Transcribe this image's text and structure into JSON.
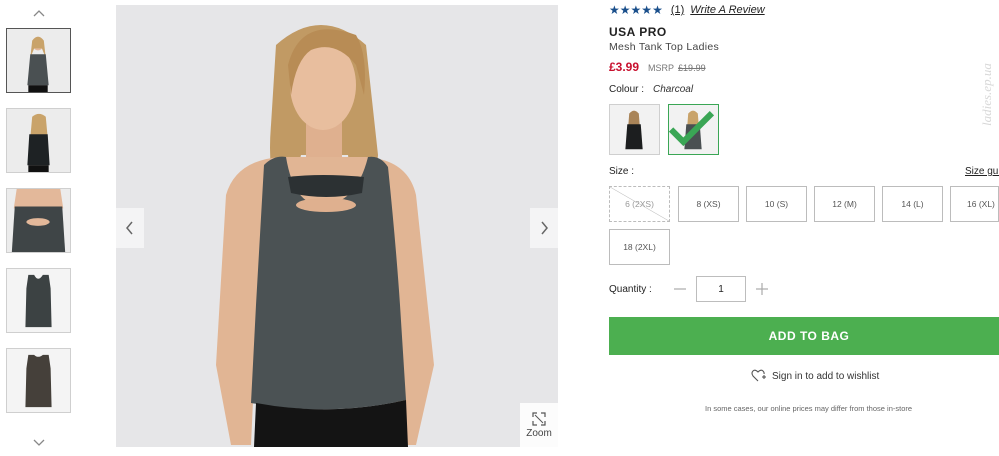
{
  "gallery": {
    "thumbnails": [
      {
        "alt": "front"
      },
      {
        "alt": "back"
      },
      {
        "alt": "detail"
      },
      {
        "alt": "flat front"
      },
      {
        "alt": "flat back"
      }
    ],
    "zoom_label": "Zoom",
    "icons": {
      "up": "chevron-up-icon",
      "down": "chevron-down-icon",
      "prev": "chevron-left-icon",
      "next": "chevron-right-icon",
      "zoom": "expand-icon"
    }
  },
  "product": {
    "rating_stars": 5,
    "review_count": "(1)",
    "write_review": "Write A Review",
    "brand": "USA PRO",
    "name": "Mesh Tank Top Ladies",
    "price": "£3.99",
    "msrp_label": "MSRP",
    "msrp_value": "£19.99",
    "colour_label": "Colour :",
    "colour_value": "Charcoal",
    "colour_swatches": [
      {
        "name": "black",
        "selected": false
      },
      {
        "name": "charcoal",
        "selected": true
      }
    ],
    "size_label": "Size :",
    "size_guide": "Size gui",
    "sizes": [
      {
        "label": "6 (2XS)",
        "available": false
      },
      {
        "label": "8 (XS)",
        "available": true
      },
      {
        "label": "10 (S)",
        "available": true
      },
      {
        "label": "12 (M)",
        "available": true
      },
      {
        "label": "14 (L)",
        "available": true
      },
      {
        "label": "16 (XL)",
        "available": true
      },
      {
        "label": "18 (2XL)",
        "available": true
      }
    ],
    "quantity_label": "Quantity :",
    "quantity_value": "1",
    "add_to_bag": "ADD TO BAG",
    "wishlist": "Sign in to add to wishlist",
    "disclaimer": "In some cases, our online prices may differ from those in-store",
    "watermark": "ladies.ep.ua"
  },
  "colors": {
    "price_red": "#c8102e",
    "star_blue": "#1a4f8b",
    "add_green": "#4caf50",
    "selected_green": "#3aa655"
  }
}
